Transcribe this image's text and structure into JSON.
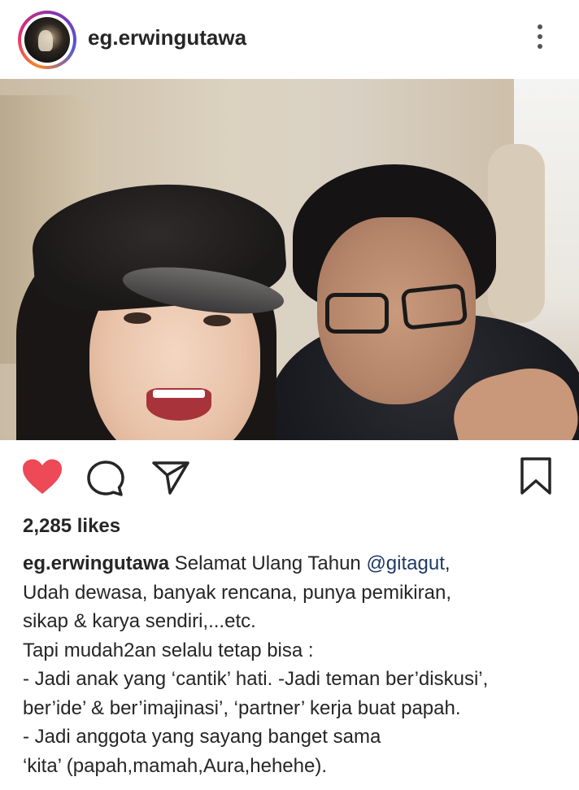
{
  "post": {
    "username": "eg.erwingutawa",
    "likes_text": "2,285 likes",
    "caption": {
      "author": "eg.erwingutawa",
      "first_line_text": " Selamat Ulang Tahun ",
      "mention": "@gitagut",
      "first_line_suffix": ",",
      "lines": [
        "Udah dewasa, banyak rencana, punya pemikiran,",
        "sikap & karya sendiri,...etc.",
        "Tapi mudah2an selalu tetap bisa :",
        "- Jadi anak yang ‘cantik’ hati. -Jadi teman ber’diskusi’,",
        "ber’ide’ & ber’imajinasi’, ‘partner’ kerja buat papah.",
        "- Jadi anggota yang sayang banget sama",
        "‘kita’ (papah,mamah,Aura,hehehe)."
      ]
    }
  },
  "icons": {
    "more": "more-vertical-icon",
    "like": "heart-icon",
    "comment": "comment-icon",
    "share": "send-icon",
    "save": "bookmark-icon"
  },
  "colors": {
    "like_red": "#ed4956",
    "text": "#262626",
    "mention": "#1f3a66"
  }
}
